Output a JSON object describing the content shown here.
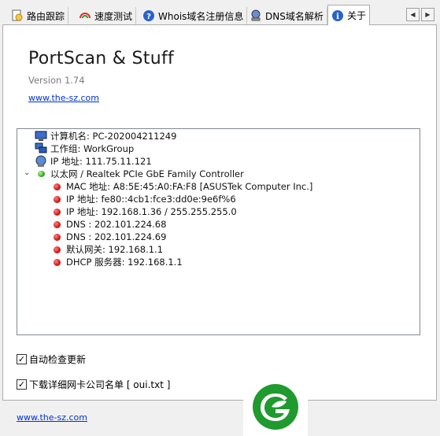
{
  "tabs": [
    {
      "label": "路由跟踪",
      "icon": "route-trace-icon"
    },
    {
      "label": "速度测试",
      "icon": "speed-gauge-icon"
    },
    {
      "label": "Whois域名注册信息",
      "icon": "help-icon"
    },
    {
      "label": "DNS域名解析",
      "icon": "dns-server-icon"
    },
    {
      "label": "关于",
      "icon": "info-icon"
    }
  ],
  "tab_scroll": {
    "left": "◀",
    "right": "▶"
  },
  "about": {
    "app_name": "PortScan & Stuff",
    "version": "Version 1.74",
    "website": "www.the-sz.com"
  },
  "tree": {
    "computer_name": "计算机名: PC-202004211249",
    "workgroup": "工作组: WorkGroup",
    "ip_address": "IP 地址: 111.75.11.121",
    "adapter": "以太网 / Realtek PCIe GbE Family Controller",
    "expander": "⌄",
    "adapter_details": [
      "MAC 地址: A8:5E:45:A0:FA:F8 [ASUSTek Computer Inc.]",
      "IP 地址: fe80::4cb1:fce3:dd0e:9e6f%6",
      "IP 地址: 192.168.1.36 / 255.255.255.0",
      "DNS : 202.101.224.68",
      "DNS : 202.101.224.69",
      "默认网关: 192.168.1.1",
      "DHCP 服务器: 192.168.1.1"
    ]
  },
  "options": {
    "auto_update": {
      "label": "自动检查更新",
      "checked": true
    },
    "download_oui": {
      "label": "下载详细网卡公司名单 [ oui.txt ]",
      "checked": true
    },
    "check_mark": "✓"
  },
  "footer": {
    "website": "www.the-sz.com"
  },
  "colors": {
    "link": "#0033cc",
    "status_red": "#d01818",
    "status_green": "#3caa25",
    "logo_green": "#1f9a2e"
  }
}
